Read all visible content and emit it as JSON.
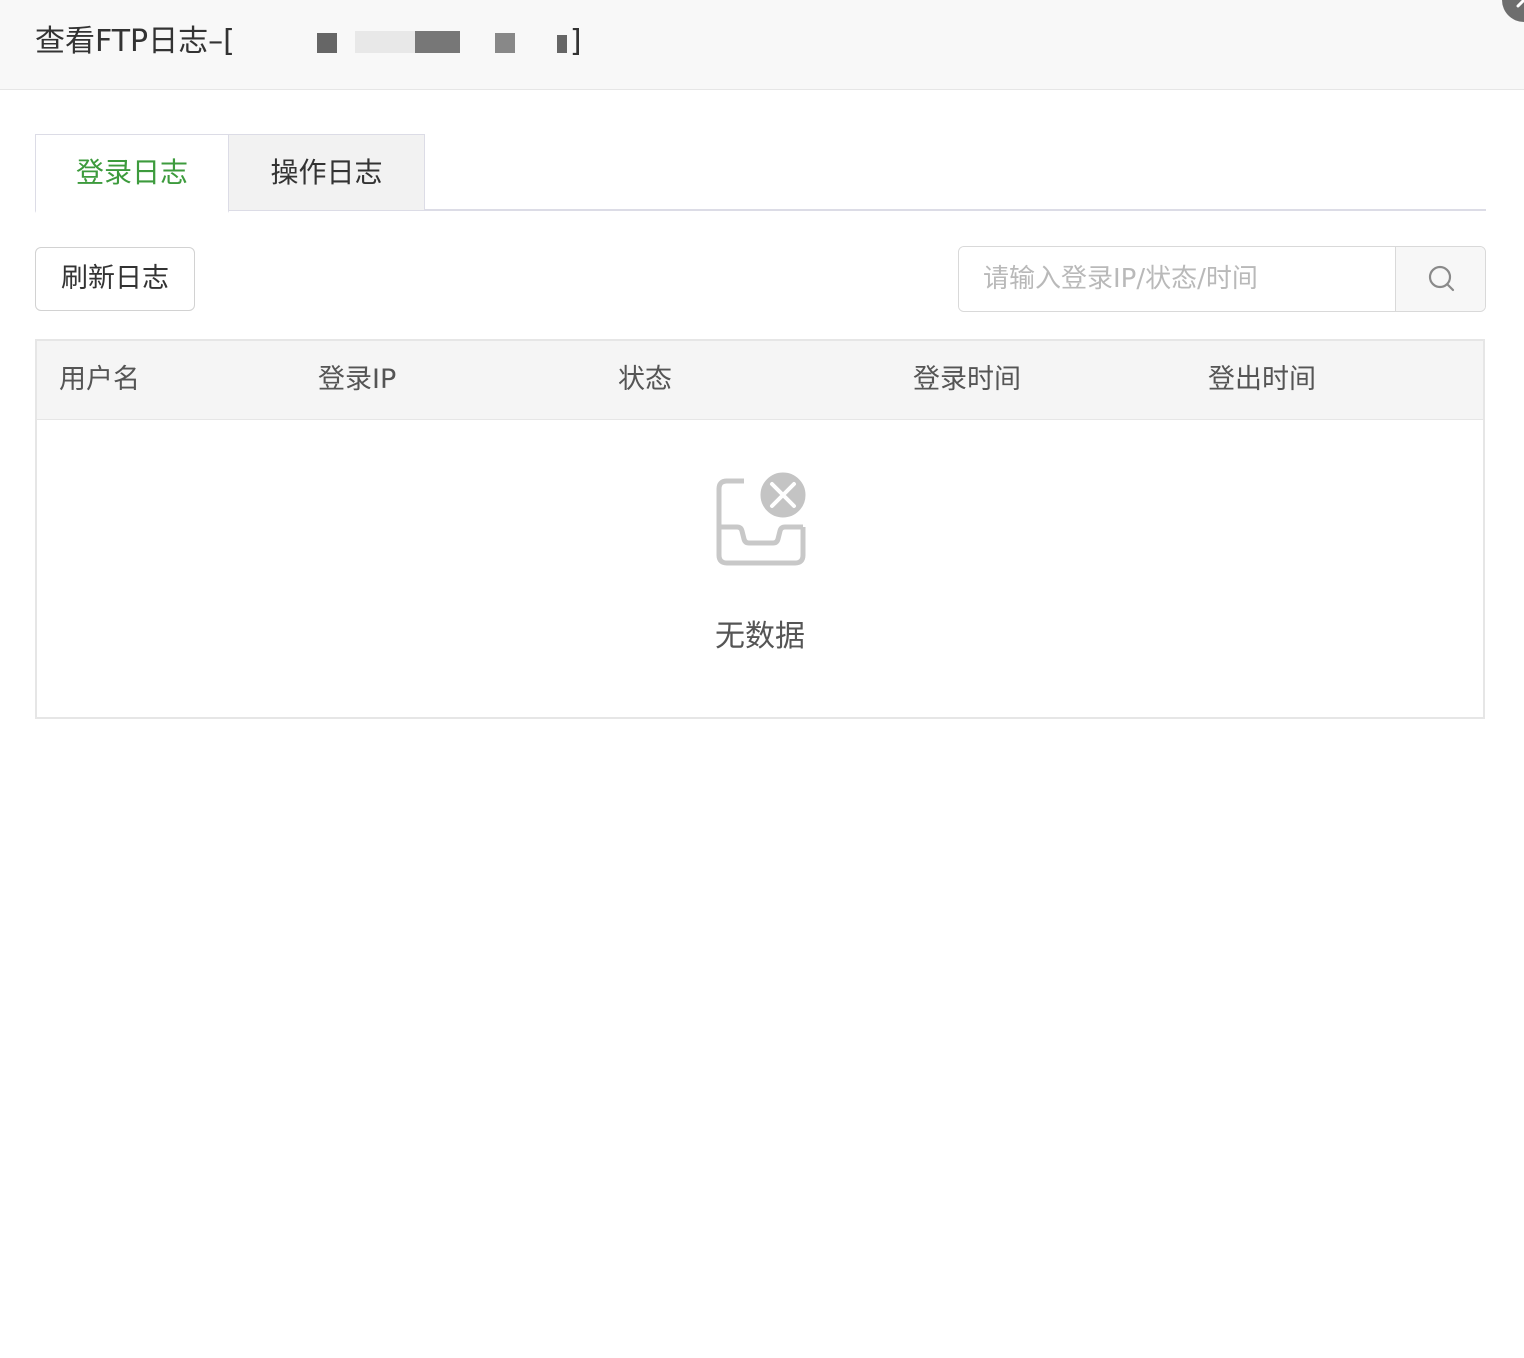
{
  "dialog": {
    "title": "查看FTP日志–[",
    "title_suffix": "]",
    "close_icon": "close-icon"
  },
  "tabs": [
    {
      "label": "登录日志",
      "active": true
    },
    {
      "label": "操作日志",
      "active": false
    }
  ],
  "toolbar": {
    "refresh_label": "刷新日志"
  },
  "search": {
    "placeholder": "请输入登录IP/状态/时间",
    "value": "",
    "icon": "search-icon"
  },
  "table": {
    "columns": [
      "用户名",
      "登录IP",
      "状态",
      "登录时间",
      "登出时间"
    ],
    "rows": [],
    "empty_text": "无数据",
    "empty_icon": "empty-inbox-icon"
  },
  "colors": {
    "accent": "#3d9b3d",
    "header_bg": "#f8f8f8",
    "border": "#e6e6e6"
  }
}
